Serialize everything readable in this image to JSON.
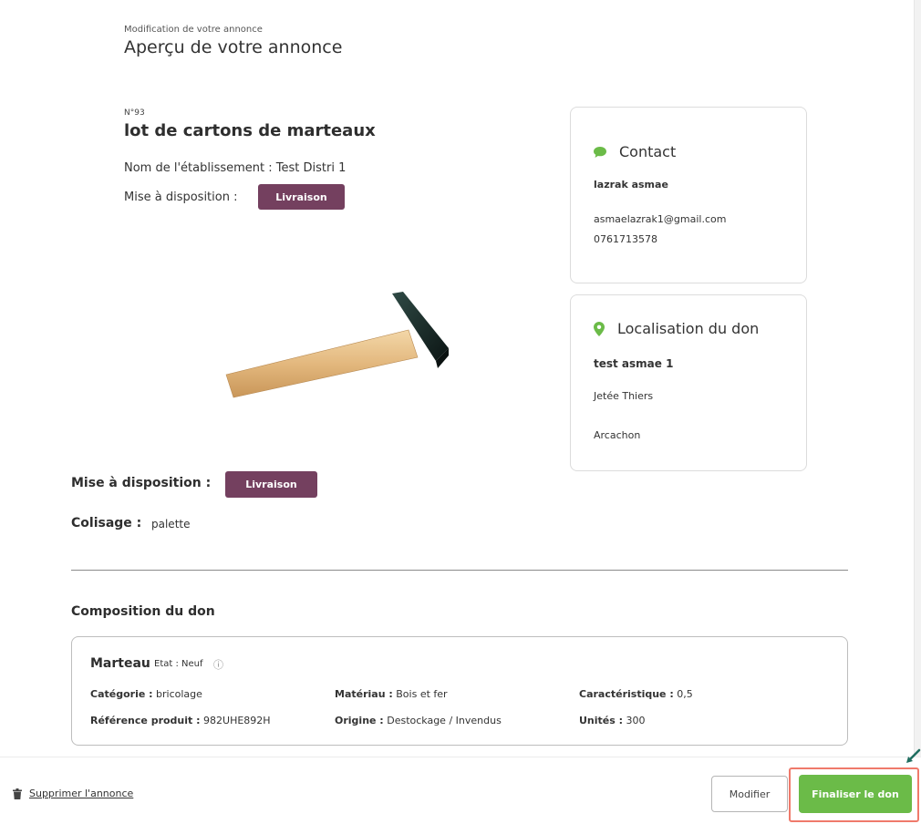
{
  "header": {
    "eyebrow": "Modification de votre annonce",
    "title": "Aperçu de votre annonce"
  },
  "listing": {
    "number": "N°93",
    "title": "lot de cartons de marteaux",
    "establishment_label": "Nom de l'établissement :",
    "establishment_value": "Test Distri 1",
    "availability_label": "Mise à disposition :",
    "availability_value": "Livraison"
  },
  "contact": {
    "heading": "Contact",
    "icon": "chat-bubble-icon",
    "name": "lazrak asmae",
    "email": "asmaelazrak1@gmail.com",
    "phone": "0761713578"
  },
  "location": {
    "heading": "Localisation du don",
    "icon": "map-pin-icon",
    "name": "test asmae 1",
    "street": "Jetée Thiers",
    "city": "Arcachon"
  },
  "details": {
    "availability_label": "Mise à disposition :",
    "availability_value": "Livraison",
    "packaging_label": "Colisage :",
    "packaging_value": "palette"
  },
  "composition": {
    "title": "Composition du don",
    "item": {
      "name": "Marteau",
      "state": "Etat : Neuf",
      "category_label": "Catégorie :",
      "category_value": "bricolage",
      "material_label": "Matériau :",
      "material_value": "Bois et fer",
      "characteristic_label": "Caractéristique :",
      "characteristic_value": "0,5",
      "reference_label": "Référence produit :",
      "reference_value": "982UHE892H",
      "origin_label": "Origine :",
      "origin_value": "Destockage / Invendus",
      "units_label": "Unités :",
      "units_value": "300"
    }
  },
  "footer": {
    "delete_label": "Supprimer l'annonce",
    "modify_label": "Modifier",
    "finalize_label": "Finaliser le don"
  },
  "colors": {
    "accent_purple": "#74405f",
    "accent_green": "#6bbb48",
    "highlight_red": "#ef7a6b"
  }
}
